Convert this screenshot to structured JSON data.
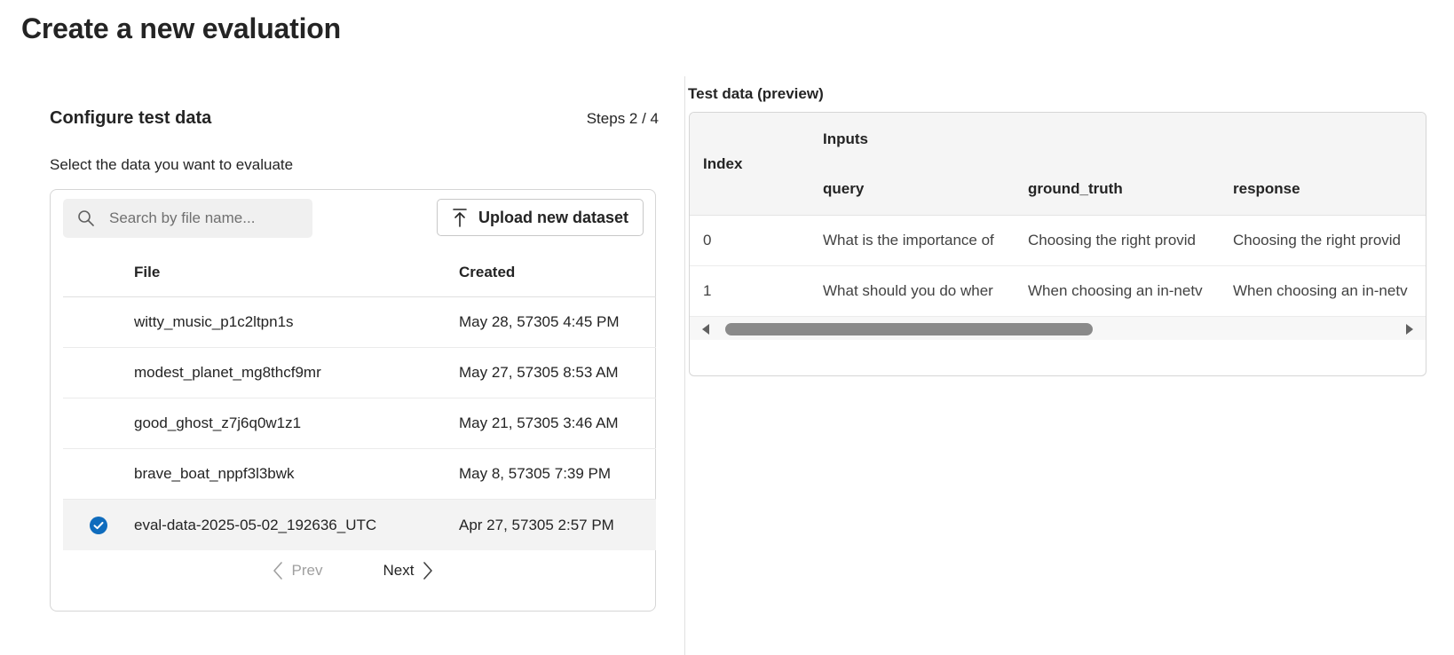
{
  "page": {
    "title": "Create a new evaluation"
  },
  "config": {
    "title": "Configure test data",
    "steps": "Steps 2 / 4",
    "instruction": "Select the data you want to evaluate",
    "search": {
      "placeholder": "Search by file name...",
      "icon": "search-icon"
    },
    "upload_label": "Upload new dataset",
    "columns": {
      "file": "File",
      "created": "Created"
    },
    "rows": [
      {
        "file": "witty_music_p1c2ltpn1s",
        "created": "May 28, 57305 4:45 PM",
        "selected": false
      },
      {
        "file": "modest_planet_mg8thcf9mr",
        "created": "May 27, 57305 8:53 AM",
        "selected": false
      },
      {
        "file": "good_ghost_z7j6q0w1z1",
        "created": "May 21, 57305 3:46 AM",
        "selected": false
      },
      {
        "file": "brave_boat_nppf3l3bwk",
        "created": "May 8, 57305 7:39 PM",
        "selected": false
      },
      {
        "file": "eval-data-2025-05-02_192636_UTC",
        "created": "Apr 27, 57305 2:57 PM",
        "selected": true
      }
    ],
    "pager": {
      "prev": "Prev",
      "next": "Next"
    }
  },
  "preview": {
    "title": "Test data (preview)",
    "index_header": "Index",
    "group_header": "Inputs",
    "columns": [
      "query",
      "ground_truth",
      "response"
    ],
    "rows": [
      {
        "index": "0",
        "query": "What is the importance of",
        "ground_truth": "Choosing the right provid",
        "response": "Choosing the right provid"
      },
      {
        "index": "1",
        "query": "What should you do wher",
        "ground_truth": "When choosing an in-netv",
        "response": "When choosing an in-netv"
      }
    ],
    "scrollbar_position": 0.45
  },
  "colors": {
    "accent": "#0f6cbd",
    "selected_row": "#f3f3f3"
  }
}
